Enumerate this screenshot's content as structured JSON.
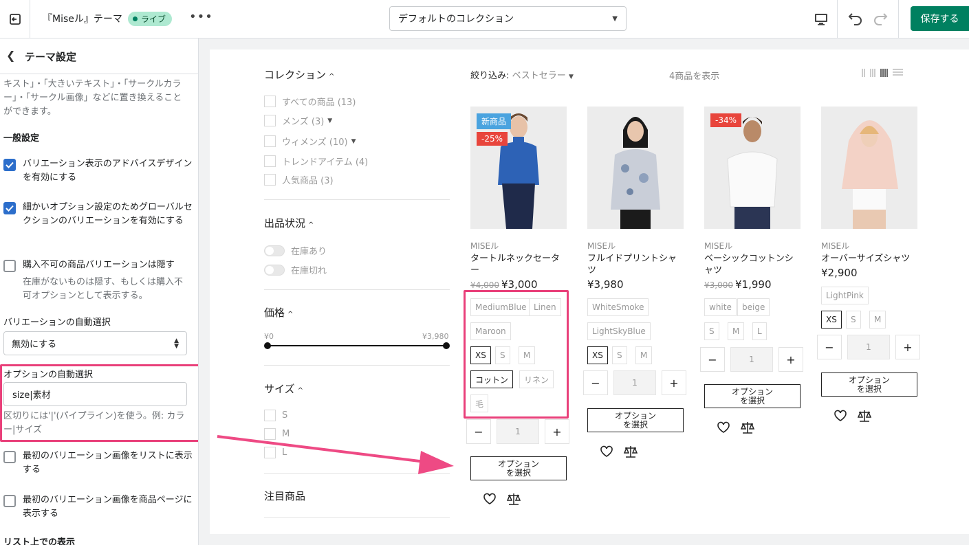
{
  "topbar": {
    "theme_title": "『Miseル』テーマ",
    "live_label": "ライブ",
    "more_label": "•••",
    "template_select": "デフォルトのコレクション",
    "save_label": "保存する"
  },
  "sidebar": {
    "title": "テーマ設定",
    "desc_line": "キスト」・「大きいテキスト」・「サークルカラー」・「サークル画像」などに置き換えることができます。",
    "section_general": "一般設定",
    "opt1": "バリエーション表示のアドバイスデザインを有効にする",
    "opt2": "細かいオプション設定のためグローバルセクションのバリエーションを有効にする",
    "opt3": "購入不可の商品バリエーションは隠す",
    "opt3_help": "在庫がないものは隠す、もしくは購入不可オプションとして表示する。",
    "auto_variant_label": "バリエーションの自動選択",
    "auto_variant_value": "無効にする",
    "auto_option_label": "オプションの自動選択",
    "auto_option_value": "size|素材",
    "auto_option_help": "区切りには'|'(パイプライン)を使う。例: カラー|サイズ",
    "opt4": "最初のバリエーション画像をリストに表示する",
    "opt5": "最初のバリエーション画像を商品ページに表示する",
    "section_list": "リスト上での表示"
  },
  "filters": {
    "collection_head": "コレクション",
    "collection_items": [
      "すべての商品 (13)",
      "メンズ (3)",
      "ウィメンズ (10)",
      "トレンドアイテム (4)",
      "人気商品 (3)"
    ],
    "stock_head": "出品状況",
    "stock_items": [
      "在庫あり",
      "在庫切れ"
    ],
    "price_head": "価格",
    "price_min": "¥0",
    "price_max": "¥3,980",
    "size_head": "サイズ",
    "size_items": [
      "S",
      "M",
      "L"
    ],
    "featured_head": "注目商品"
  },
  "toolbar": {
    "sort_label": "絞り込み:",
    "sort_value": "ベストセラー",
    "count_label": "4商品を表示"
  },
  "products": [
    {
      "brand": "MISEル",
      "name": "タートルネックセーター",
      "old_price": "¥4,000",
      "price": "¥3,000",
      "badge_new": "新商品",
      "badge_sale": "-25%",
      "colors": [
        "MediumBlue",
        "Linen",
        "Maroon"
      ],
      "sizes": [
        "XS",
        "S",
        "M"
      ],
      "materials": [
        "コットン",
        "リネン",
        "毛"
      ],
      "qty": "1",
      "option_button": "オプション\nを選択"
    },
    {
      "brand": "MISEル",
      "name": "フルイドプリントシャツ",
      "price": "¥3,980",
      "colors": [
        "WhiteSmoke",
        "LightSkyBlue"
      ],
      "sizes": [
        "XS",
        "S",
        "M"
      ],
      "qty": "1",
      "option_button": "オプション\nを選択"
    },
    {
      "brand": "MISEル",
      "name": "ベーシックコットンシャツ",
      "old_price": "¥3,000",
      "price": "¥1,990",
      "badge_sale": "-34%",
      "colors": [
        "white",
        "beige"
      ],
      "sizes": [
        "S",
        "M",
        "L"
      ],
      "qty": "1",
      "option_button": "オプション\nを選択"
    },
    {
      "brand": "MISEル",
      "name": "オーバーサイズシャツ",
      "price": "¥2,900",
      "colors": [
        "LightPink"
      ],
      "sizes": [
        "XS",
        "S",
        "M"
      ],
      "qty": "1",
      "option_button": "オプション\nを選択"
    }
  ],
  "colors": {
    "accent_green": "#008060",
    "highlight_pink": "#e9407a",
    "checkbox_blue": "#2c6ecb",
    "badge_new": "#4aa3df",
    "badge_sale": "#e8453c"
  }
}
